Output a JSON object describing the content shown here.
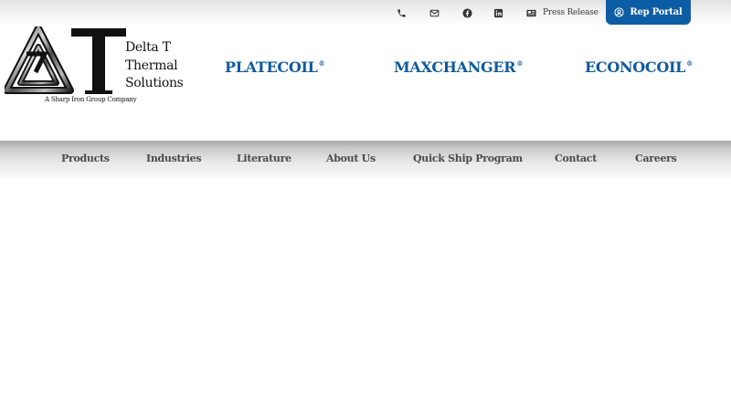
{
  "topbar": {
    "icons": [
      "phone-icon",
      "envelope-icon",
      "facebook-icon",
      "linkedin-icon"
    ],
    "press_release": {
      "icon": "newspaper-icon",
      "label": "Press Release"
    },
    "rep_portal": {
      "icon": "user-circle-icon",
      "label": "Rep Portal"
    }
  },
  "logo": {
    "name_lines": [
      "Delta T",
      "Thermal",
      "Solutions"
    ],
    "tagline": "A Sharp Iron Group Company"
  },
  "brands": [
    {
      "label": "PLATECOIL",
      "mark": "®"
    },
    {
      "label": "MAXCHANGER",
      "mark": "®"
    },
    {
      "label": "ECONOCOIL",
      "mark": "®"
    }
  ],
  "nav": {
    "items": [
      {
        "label": "Products"
      },
      {
        "label": "Industries"
      },
      {
        "label": "Literature"
      },
      {
        "label": "About Us"
      },
      {
        "label": "Quick Ship Program"
      },
      {
        "label": "Contact"
      },
      {
        "label": "Careers"
      }
    ]
  },
  "colors": {
    "brand_blue": "#0f5a9e",
    "rep_portal_bg": "#0d5da5",
    "nav_text": "#4a4a4a",
    "topbar_icon": "#333333"
  }
}
